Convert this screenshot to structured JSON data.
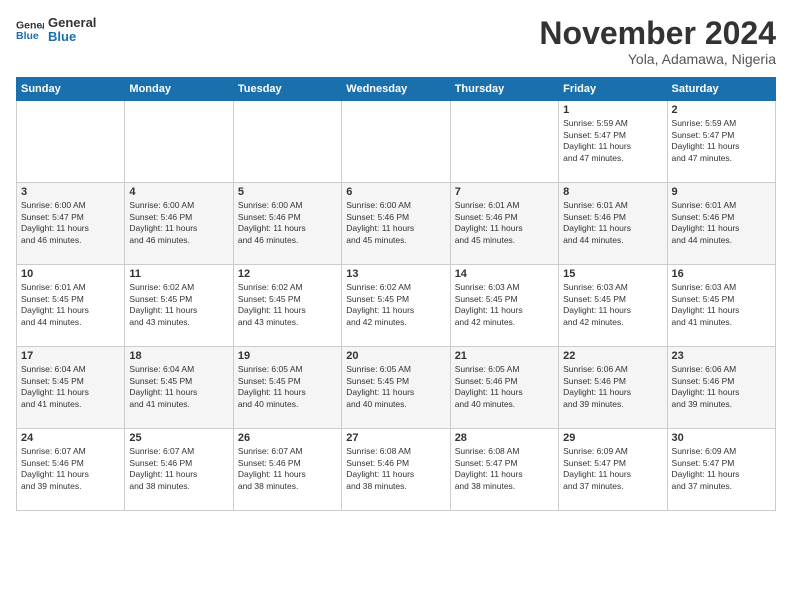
{
  "logo": {
    "general": "General",
    "blue": "Blue"
  },
  "title": "November 2024",
  "location": "Yola, Adamawa, Nigeria",
  "days_header": [
    "Sunday",
    "Monday",
    "Tuesday",
    "Wednesday",
    "Thursday",
    "Friday",
    "Saturday"
  ],
  "weeks": [
    [
      {
        "day": "",
        "info": ""
      },
      {
        "day": "",
        "info": ""
      },
      {
        "day": "",
        "info": ""
      },
      {
        "day": "",
        "info": ""
      },
      {
        "day": "",
        "info": ""
      },
      {
        "day": "1",
        "info": "Sunrise: 5:59 AM\nSunset: 5:47 PM\nDaylight: 11 hours\nand 47 minutes."
      },
      {
        "day": "2",
        "info": "Sunrise: 5:59 AM\nSunset: 5:47 PM\nDaylight: 11 hours\nand 47 minutes."
      }
    ],
    [
      {
        "day": "3",
        "info": "Sunrise: 6:00 AM\nSunset: 5:47 PM\nDaylight: 11 hours\nand 46 minutes."
      },
      {
        "day": "4",
        "info": "Sunrise: 6:00 AM\nSunset: 5:46 PM\nDaylight: 11 hours\nand 46 minutes."
      },
      {
        "day": "5",
        "info": "Sunrise: 6:00 AM\nSunset: 5:46 PM\nDaylight: 11 hours\nand 46 minutes."
      },
      {
        "day": "6",
        "info": "Sunrise: 6:00 AM\nSunset: 5:46 PM\nDaylight: 11 hours\nand 45 minutes."
      },
      {
        "day": "7",
        "info": "Sunrise: 6:01 AM\nSunset: 5:46 PM\nDaylight: 11 hours\nand 45 minutes."
      },
      {
        "day": "8",
        "info": "Sunrise: 6:01 AM\nSunset: 5:46 PM\nDaylight: 11 hours\nand 44 minutes."
      },
      {
        "day": "9",
        "info": "Sunrise: 6:01 AM\nSunset: 5:46 PM\nDaylight: 11 hours\nand 44 minutes."
      }
    ],
    [
      {
        "day": "10",
        "info": "Sunrise: 6:01 AM\nSunset: 5:45 PM\nDaylight: 11 hours\nand 44 minutes."
      },
      {
        "day": "11",
        "info": "Sunrise: 6:02 AM\nSunset: 5:45 PM\nDaylight: 11 hours\nand 43 minutes."
      },
      {
        "day": "12",
        "info": "Sunrise: 6:02 AM\nSunset: 5:45 PM\nDaylight: 11 hours\nand 43 minutes."
      },
      {
        "day": "13",
        "info": "Sunrise: 6:02 AM\nSunset: 5:45 PM\nDaylight: 11 hours\nand 42 minutes."
      },
      {
        "day": "14",
        "info": "Sunrise: 6:03 AM\nSunset: 5:45 PM\nDaylight: 11 hours\nand 42 minutes."
      },
      {
        "day": "15",
        "info": "Sunrise: 6:03 AM\nSunset: 5:45 PM\nDaylight: 11 hours\nand 42 minutes."
      },
      {
        "day": "16",
        "info": "Sunrise: 6:03 AM\nSunset: 5:45 PM\nDaylight: 11 hours\nand 41 minutes."
      }
    ],
    [
      {
        "day": "17",
        "info": "Sunrise: 6:04 AM\nSunset: 5:45 PM\nDaylight: 11 hours\nand 41 minutes."
      },
      {
        "day": "18",
        "info": "Sunrise: 6:04 AM\nSunset: 5:45 PM\nDaylight: 11 hours\nand 41 minutes."
      },
      {
        "day": "19",
        "info": "Sunrise: 6:05 AM\nSunset: 5:45 PM\nDaylight: 11 hours\nand 40 minutes."
      },
      {
        "day": "20",
        "info": "Sunrise: 6:05 AM\nSunset: 5:45 PM\nDaylight: 11 hours\nand 40 minutes."
      },
      {
        "day": "21",
        "info": "Sunrise: 6:05 AM\nSunset: 5:46 PM\nDaylight: 11 hours\nand 40 minutes."
      },
      {
        "day": "22",
        "info": "Sunrise: 6:06 AM\nSunset: 5:46 PM\nDaylight: 11 hours\nand 39 minutes."
      },
      {
        "day": "23",
        "info": "Sunrise: 6:06 AM\nSunset: 5:46 PM\nDaylight: 11 hours\nand 39 minutes."
      }
    ],
    [
      {
        "day": "24",
        "info": "Sunrise: 6:07 AM\nSunset: 5:46 PM\nDaylight: 11 hours\nand 39 minutes."
      },
      {
        "day": "25",
        "info": "Sunrise: 6:07 AM\nSunset: 5:46 PM\nDaylight: 11 hours\nand 38 minutes."
      },
      {
        "day": "26",
        "info": "Sunrise: 6:07 AM\nSunset: 5:46 PM\nDaylight: 11 hours\nand 38 minutes."
      },
      {
        "day": "27",
        "info": "Sunrise: 6:08 AM\nSunset: 5:46 PM\nDaylight: 11 hours\nand 38 minutes."
      },
      {
        "day": "28",
        "info": "Sunrise: 6:08 AM\nSunset: 5:47 PM\nDaylight: 11 hours\nand 38 minutes."
      },
      {
        "day": "29",
        "info": "Sunrise: 6:09 AM\nSunset: 5:47 PM\nDaylight: 11 hours\nand 37 minutes."
      },
      {
        "day": "30",
        "info": "Sunrise: 6:09 AM\nSunset: 5:47 PM\nDaylight: 11 hours\nand 37 minutes."
      }
    ]
  ]
}
